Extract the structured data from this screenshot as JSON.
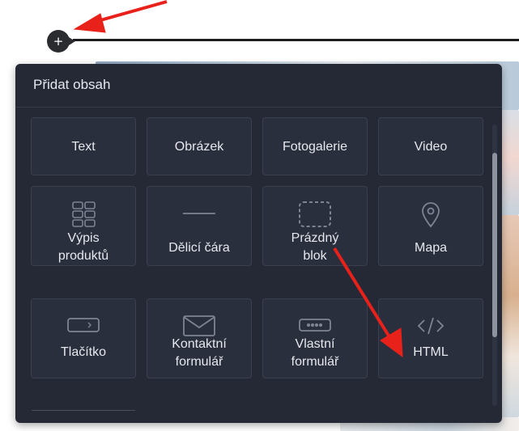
{
  "add_button": {
    "symbol": "+"
  },
  "panel": {
    "title": "Přidat obsah",
    "tiles": [
      {
        "label": "Text",
        "icon": "none"
      },
      {
        "label": "Obrázek",
        "icon": "none"
      },
      {
        "label": "Fotogalerie",
        "icon": "none"
      },
      {
        "label": "Video",
        "icon": "none"
      },
      {
        "label": "Výpis\nproduktů",
        "icon": "grid-icon"
      },
      {
        "label": "Dělicí čára",
        "icon": "divider-line-icon"
      },
      {
        "label": "Prázdný\nblok",
        "icon": "dashed-box-icon"
      },
      {
        "label": "Mapa",
        "icon": "map-pin-icon"
      },
      {
        "label": "Tlačítko",
        "icon": "button-icon"
      },
      {
        "label": "Kontaktní\nformulář",
        "icon": "envelope-icon"
      },
      {
        "label": "Vlastní\nformulář",
        "icon": "custom-form-icon"
      },
      {
        "label": "HTML",
        "icon": "code-icon"
      }
    ]
  },
  "colors": {
    "panel_bg": "#252936",
    "tile_bg": "#2a2f3d",
    "icon_color": "#7d8494",
    "annotation_arrow": "#e8221b"
  }
}
